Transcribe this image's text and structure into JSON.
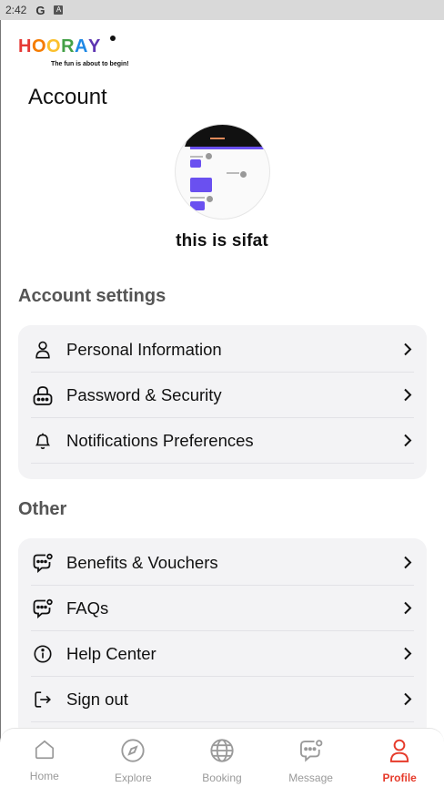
{
  "status_bar": {
    "time": "2:42",
    "g_label": "G",
    "a_label": "A"
  },
  "logo": {
    "letters": [
      {
        "ch": "H",
        "color": "#e53935"
      },
      {
        "ch": "O",
        "color": "#f57c00"
      },
      {
        "ch": "O",
        "color": "#fbc02d"
      },
      {
        "ch": "R",
        "color": "#43a047"
      },
      {
        "ch": "A",
        "color": "#1e88e5"
      },
      {
        "ch": "Y",
        "color": "#5e35b1"
      }
    ],
    "tagline": "The fun is about to begin!"
  },
  "page": {
    "title": "Account",
    "username": "this is sifat"
  },
  "account_settings": {
    "title": "Account settings",
    "items": [
      {
        "label": "Personal Information",
        "icon": "user-icon"
      },
      {
        "label": "Password & Security",
        "icon": "lock-icon"
      },
      {
        "label": "Notifications Preferences",
        "icon": "bell-icon"
      }
    ]
  },
  "other": {
    "title": "Other",
    "items": [
      {
        "label": "Benefits & Vouchers",
        "icon": "chat-badge-icon"
      },
      {
        "label": "FAQs",
        "icon": "chat-badge-icon"
      },
      {
        "label": "Help Center",
        "icon": "info-icon"
      },
      {
        "label": "Sign out",
        "icon": "sign-out-icon"
      }
    ]
  },
  "bottom_nav": {
    "items": [
      {
        "label": "Home",
        "icon": "home-icon",
        "active": false
      },
      {
        "label": "Explore",
        "icon": "compass-icon",
        "active": false
      },
      {
        "label": "Booking",
        "icon": "globe-icon",
        "active": false
      },
      {
        "label": "Message",
        "icon": "message-icon",
        "active": false
      },
      {
        "label": "Profile",
        "icon": "profile-icon",
        "active": true
      }
    ],
    "active_color": "#e63a2a",
    "inactive_color": "#9a9a9a"
  }
}
